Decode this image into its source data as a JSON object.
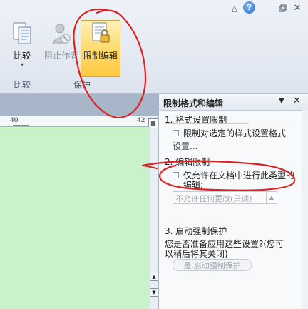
{
  "ribbon": {
    "compare": {
      "label": "比较",
      "icon": "compare-documents-icon"
    },
    "block_authors": {
      "label": "阻止作者",
      "icon": "block-authors-icon"
    },
    "restrict_editing": {
      "label": "限制编辑",
      "icon": "restrict-editing-icon"
    },
    "groups": [
      {
        "label": "比较"
      },
      {
        "label": "保护"
      }
    ],
    "window_controls": [
      "minimize-ribbon-icon",
      "help-icon",
      "restore-icon",
      "close-icon"
    ],
    "help_glyph": "?"
  },
  "ruler": {
    "mark": "40",
    "mark2": "42"
  },
  "pane": {
    "title": "限制格式和编辑",
    "section1": {
      "heading": "1. 格式设置限制",
      "option": "限制对选定的样式设置格式",
      "settings_link": "设置..."
    },
    "section2": {
      "heading": "2. 编辑限制",
      "option_line1": "仅允许在文档中进行此类型的",
      "option_line2": "编辑:",
      "dropdown_value": "不允许任何更改(只读)"
    },
    "section3": {
      "heading": "3. 启动强制保护",
      "question_line1": "您是否准备应用这些设置?(您可",
      "question_line2": "以稍后将其关闭)",
      "start_button": "是,启动强制保护"
    }
  },
  "colors": {
    "annotation": "#e02020",
    "page": "#c9f2cb",
    "highlight": "#ffd868"
  }
}
